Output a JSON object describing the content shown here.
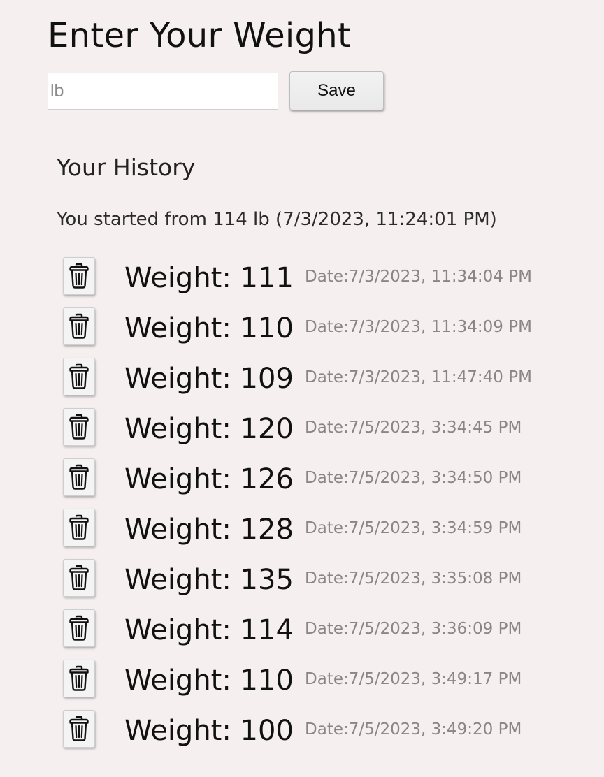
{
  "header": {
    "title": "Enter Your Weight"
  },
  "form": {
    "input_placeholder": "lb",
    "input_value": "",
    "save_label": "Save"
  },
  "history": {
    "title": "Your History",
    "start_text": "You started from 114 lb (7/3/2023, 11:24:01 PM)",
    "delete_icon": "trash-icon",
    "entries": [
      {
        "weight": "Weight: 111",
        "date": "Date:7/3/2023, 11:34:04 PM"
      },
      {
        "weight": "Weight: 110",
        "date": "Date:7/3/2023, 11:34:09 PM"
      },
      {
        "weight": "Weight: 109",
        "date": "Date:7/3/2023, 11:47:40 PM"
      },
      {
        "weight": "Weight: 120",
        "date": "Date:7/5/2023, 3:34:45 PM"
      },
      {
        "weight": "Weight: 126",
        "date": "Date:7/5/2023, 3:34:50 PM"
      },
      {
        "weight": "Weight: 128",
        "date": "Date:7/5/2023, 3:34:59 PM"
      },
      {
        "weight": "Weight: 135",
        "date": "Date:7/5/2023, 3:35:08 PM"
      },
      {
        "weight": "Weight: 114",
        "date": "Date:7/5/2023, 3:36:09 PM"
      },
      {
        "weight": "Weight: 110",
        "date": "Date:7/5/2023, 3:49:17 PM"
      },
      {
        "weight": "Weight: 100",
        "date": "Date:7/5/2023, 3:49:20 PM"
      }
    ]
  },
  "colors": {
    "background": "#f5eff0",
    "date_text": "#8a8686"
  }
}
